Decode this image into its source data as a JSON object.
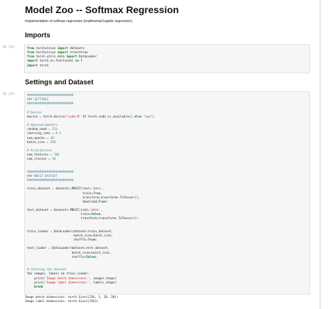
{
  "notebook": {
    "title": "Model Zoo -- Softmax Regression",
    "description": "Implementation of softmax regression (multinomial logistic regression).",
    "sections": {
      "imports": "Imports",
      "settings": "Settings and Dataset"
    },
    "cells": [
      {
        "prompt": "In [1]:",
        "lines": [
          [
            [
              "k",
              "from"
            ],
            [
              "p",
              " torchvision "
            ],
            [
              "k",
              "import"
            ],
            [
              "p",
              " datasets"
            ]
          ],
          [
            [
              "k",
              "from"
            ],
            [
              "p",
              " torchvision "
            ],
            [
              "k",
              "import"
            ],
            [
              "p",
              " transforms"
            ]
          ],
          [
            [
              "k",
              "from"
            ],
            [
              "p",
              " torch.utils.data "
            ],
            [
              "k",
              "import"
            ],
            [
              "p",
              " DataLoader"
            ]
          ],
          [
            [
              "k",
              "import"
            ],
            [
              "p",
              " torch.nn.functional "
            ],
            [
              "k",
              "as"
            ],
            [
              "p",
              " F"
            ]
          ],
          [
            [
              "k",
              "import"
            ],
            [
              "p",
              " torch"
            ]
          ]
        ]
      },
      {
        "prompt": "In [2]:",
        "lines": [
          [
            [
              "c",
              "##########################"
            ]
          ],
          [
            [
              "c",
              "### SETTINGS"
            ]
          ],
          [
            [
              "c",
              "##########################"
            ]
          ],
          [],
          [
            [
              "c",
              "# Device"
            ]
          ],
          [
            [
              "p",
              "device "
            ],
            [
              "o",
              "="
            ],
            [
              "p",
              " torch.device("
            ],
            [
              "s",
              "\"cuda:0\""
            ],
            [
              "p",
              " "
            ],
            [
              "k",
              "if"
            ],
            [
              "p",
              " torch.cuda.is_available() "
            ],
            [
              "k",
              "else"
            ],
            [
              "p",
              " "
            ],
            [
              "s",
              "\"cpu\""
            ],
            [
              "p",
              ")"
            ]
          ],
          [],
          [
            [
              "c",
              "# Hyperparameters"
            ]
          ],
          [
            [
              "p",
              "random_seed "
            ],
            [
              "o",
              "="
            ],
            [
              "p",
              " "
            ],
            [
              "n",
              "123"
            ]
          ],
          [
            [
              "p",
              "learning_rate "
            ],
            [
              "o",
              "="
            ],
            [
              "p",
              " "
            ],
            [
              "n",
              "0.1"
            ]
          ],
          [
            [
              "p",
              "num_epochs "
            ],
            [
              "o",
              "="
            ],
            [
              "p",
              " "
            ],
            [
              "n",
              "10"
            ]
          ],
          [
            [
              "p",
              "batch_size "
            ],
            [
              "o",
              "="
            ],
            [
              "p",
              " "
            ],
            [
              "n",
              "256"
            ]
          ],
          [],
          [
            [
              "c",
              "# Architecture"
            ]
          ],
          [
            [
              "p",
              "num_features "
            ],
            [
              "o",
              "="
            ],
            [
              "p",
              " "
            ],
            [
              "n",
              "784"
            ]
          ],
          [
            [
              "p",
              "num_classes "
            ],
            [
              "o",
              "="
            ],
            [
              "p",
              " "
            ],
            [
              "n",
              "10"
            ]
          ],
          [],
          [],
          [
            [
              "c",
              "##########################"
            ]
          ],
          [
            [
              "c",
              "### MNIST DATASET"
            ]
          ],
          [
            [
              "c",
              "##########################"
            ]
          ],
          [],
          [
            [
              "p",
              "train_dataset "
            ],
            [
              "o",
              "="
            ],
            [
              "p",
              " datasets.MNIST(root"
            ],
            [
              "o",
              "="
            ],
            [
              "s",
              "'data'"
            ],
            [
              "p",
              ","
            ]
          ],
          [
            [
              "p",
              "                               train"
            ],
            [
              "o",
              "="
            ],
            [
              "k",
              "True"
            ],
            [
              "p",
              ","
            ]
          ],
          [
            [
              "p",
              "                               transform"
            ],
            [
              "o",
              "="
            ],
            [
              "p",
              "transforms.ToTensor(),"
            ]
          ],
          [
            [
              "p",
              "                               download"
            ],
            [
              "o",
              "="
            ],
            [
              "k",
              "True"
            ],
            [
              "p",
              ")"
            ]
          ],
          [],
          [
            [
              "p",
              "test_dataset "
            ],
            [
              "o",
              "="
            ],
            [
              "p",
              " datasets.MNIST(root"
            ],
            [
              "o",
              "="
            ],
            [
              "s",
              "'data'"
            ],
            [
              "p",
              ","
            ]
          ],
          [
            [
              "p",
              "                              train"
            ],
            [
              "o",
              "="
            ],
            [
              "k",
              "False"
            ],
            [
              "p",
              ","
            ]
          ],
          [
            [
              "p",
              "                              transform"
            ],
            [
              "o",
              "="
            ],
            [
              "p",
              "transforms.ToTensor())"
            ]
          ],
          [],
          [],
          [
            [
              "p",
              "train_loader "
            ],
            [
              "o",
              "="
            ],
            [
              "p",
              " DataLoader(dataset"
            ],
            [
              "o",
              "="
            ],
            [
              "p",
              "train_dataset,"
            ]
          ],
          [
            [
              "p",
              "                          batch_size"
            ],
            [
              "o",
              "="
            ],
            [
              "p",
              "batch_size,"
            ]
          ],
          [
            [
              "p",
              "                          shuffle"
            ],
            [
              "o",
              "="
            ],
            [
              "k",
              "True"
            ],
            [
              "p",
              ")"
            ]
          ],
          [],
          [
            [
              "p",
              "test_loader "
            ],
            [
              "o",
              "="
            ],
            [
              "p",
              " DataLoader(dataset"
            ],
            [
              "o",
              "="
            ],
            [
              "p",
              "test_dataset,"
            ]
          ],
          [
            [
              "p",
              "                         batch_size"
            ],
            [
              "o",
              "="
            ],
            [
              "p",
              "batch_size,"
            ]
          ],
          [
            [
              "p",
              "                         shuffle"
            ],
            [
              "o",
              "="
            ],
            [
              "k",
              "False"
            ],
            [
              "p",
              ")"
            ]
          ],
          [],
          [],
          [
            [
              "c",
              "# Checking the dataset"
            ]
          ],
          [
            [
              "k",
              "for"
            ],
            [
              "p",
              " images, labels "
            ],
            [
              "k",
              "in"
            ],
            [
              "p",
              " train_loader:"
            ]
          ],
          [
            [
              "p",
              "    print("
            ],
            [
              "s",
              "'Image batch dimensions:'"
            ],
            [
              "p",
              ", images.shape)"
            ]
          ],
          [
            [
              "p",
              "    print("
            ],
            [
              "s",
              "'Image label dimensions:'"
            ],
            [
              "p",
              ", labels.shape)"
            ]
          ],
          [
            [
              "p",
              "    "
            ],
            [
              "k",
              "break"
            ]
          ]
        ],
        "output": [
          "Image batch dimensions: torch.Size([256, 1, 28, 28])",
          "Image label dimensions: torch.Size([256])"
        ]
      }
    ]
  }
}
